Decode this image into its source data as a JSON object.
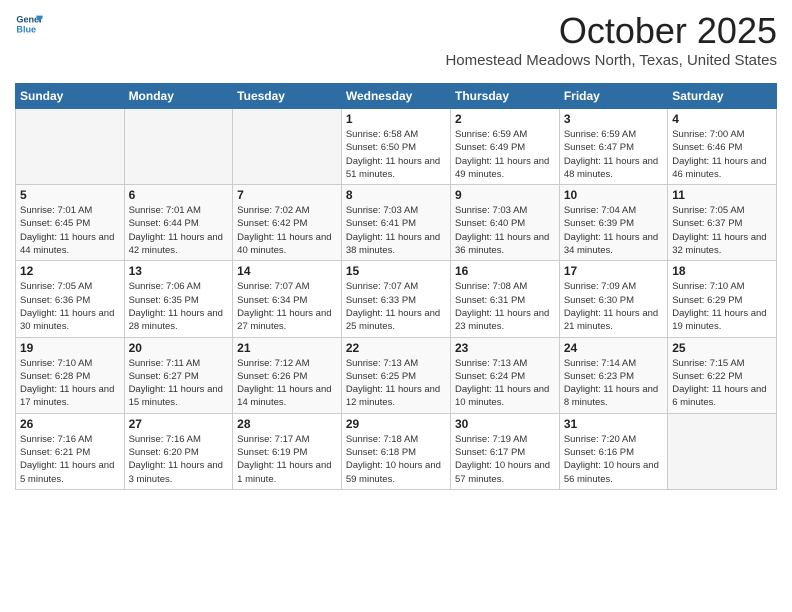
{
  "header": {
    "logo_line1": "General",
    "logo_line2": "Blue",
    "month_title": "October 2025",
    "subtitle": "Homestead Meadows North, Texas, United States"
  },
  "weekdays": [
    "Sunday",
    "Monday",
    "Tuesday",
    "Wednesday",
    "Thursday",
    "Friday",
    "Saturday"
  ],
  "weeks": [
    [
      {
        "day": "",
        "info": ""
      },
      {
        "day": "",
        "info": ""
      },
      {
        "day": "",
        "info": ""
      },
      {
        "day": "1",
        "info": "Sunrise: 6:58 AM\nSunset: 6:50 PM\nDaylight: 11 hours and 51 minutes."
      },
      {
        "day": "2",
        "info": "Sunrise: 6:59 AM\nSunset: 6:49 PM\nDaylight: 11 hours and 49 minutes."
      },
      {
        "day": "3",
        "info": "Sunrise: 6:59 AM\nSunset: 6:47 PM\nDaylight: 11 hours and 48 minutes."
      },
      {
        "day": "4",
        "info": "Sunrise: 7:00 AM\nSunset: 6:46 PM\nDaylight: 11 hours and 46 minutes."
      }
    ],
    [
      {
        "day": "5",
        "info": "Sunrise: 7:01 AM\nSunset: 6:45 PM\nDaylight: 11 hours and 44 minutes."
      },
      {
        "day": "6",
        "info": "Sunrise: 7:01 AM\nSunset: 6:44 PM\nDaylight: 11 hours and 42 minutes."
      },
      {
        "day": "7",
        "info": "Sunrise: 7:02 AM\nSunset: 6:42 PM\nDaylight: 11 hours and 40 minutes."
      },
      {
        "day": "8",
        "info": "Sunrise: 7:03 AM\nSunset: 6:41 PM\nDaylight: 11 hours and 38 minutes."
      },
      {
        "day": "9",
        "info": "Sunrise: 7:03 AM\nSunset: 6:40 PM\nDaylight: 11 hours and 36 minutes."
      },
      {
        "day": "10",
        "info": "Sunrise: 7:04 AM\nSunset: 6:39 PM\nDaylight: 11 hours and 34 minutes."
      },
      {
        "day": "11",
        "info": "Sunrise: 7:05 AM\nSunset: 6:37 PM\nDaylight: 11 hours and 32 minutes."
      }
    ],
    [
      {
        "day": "12",
        "info": "Sunrise: 7:05 AM\nSunset: 6:36 PM\nDaylight: 11 hours and 30 minutes."
      },
      {
        "day": "13",
        "info": "Sunrise: 7:06 AM\nSunset: 6:35 PM\nDaylight: 11 hours and 28 minutes."
      },
      {
        "day": "14",
        "info": "Sunrise: 7:07 AM\nSunset: 6:34 PM\nDaylight: 11 hours and 27 minutes."
      },
      {
        "day": "15",
        "info": "Sunrise: 7:07 AM\nSunset: 6:33 PM\nDaylight: 11 hours and 25 minutes."
      },
      {
        "day": "16",
        "info": "Sunrise: 7:08 AM\nSunset: 6:31 PM\nDaylight: 11 hours and 23 minutes."
      },
      {
        "day": "17",
        "info": "Sunrise: 7:09 AM\nSunset: 6:30 PM\nDaylight: 11 hours and 21 minutes."
      },
      {
        "day": "18",
        "info": "Sunrise: 7:10 AM\nSunset: 6:29 PM\nDaylight: 11 hours and 19 minutes."
      }
    ],
    [
      {
        "day": "19",
        "info": "Sunrise: 7:10 AM\nSunset: 6:28 PM\nDaylight: 11 hours and 17 minutes."
      },
      {
        "day": "20",
        "info": "Sunrise: 7:11 AM\nSunset: 6:27 PM\nDaylight: 11 hours and 15 minutes."
      },
      {
        "day": "21",
        "info": "Sunrise: 7:12 AM\nSunset: 6:26 PM\nDaylight: 11 hours and 14 minutes."
      },
      {
        "day": "22",
        "info": "Sunrise: 7:13 AM\nSunset: 6:25 PM\nDaylight: 11 hours and 12 minutes."
      },
      {
        "day": "23",
        "info": "Sunrise: 7:13 AM\nSunset: 6:24 PM\nDaylight: 11 hours and 10 minutes."
      },
      {
        "day": "24",
        "info": "Sunrise: 7:14 AM\nSunset: 6:23 PM\nDaylight: 11 hours and 8 minutes."
      },
      {
        "day": "25",
        "info": "Sunrise: 7:15 AM\nSunset: 6:22 PM\nDaylight: 11 hours and 6 minutes."
      }
    ],
    [
      {
        "day": "26",
        "info": "Sunrise: 7:16 AM\nSunset: 6:21 PM\nDaylight: 11 hours and 5 minutes."
      },
      {
        "day": "27",
        "info": "Sunrise: 7:16 AM\nSunset: 6:20 PM\nDaylight: 11 hours and 3 minutes."
      },
      {
        "day": "28",
        "info": "Sunrise: 7:17 AM\nSunset: 6:19 PM\nDaylight: 11 hours and 1 minute."
      },
      {
        "day": "29",
        "info": "Sunrise: 7:18 AM\nSunset: 6:18 PM\nDaylight: 10 hours and 59 minutes."
      },
      {
        "day": "30",
        "info": "Sunrise: 7:19 AM\nSunset: 6:17 PM\nDaylight: 10 hours and 57 minutes."
      },
      {
        "day": "31",
        "info": "Sunrise: 7:20 AM\nSunset: 6:16 PM\nDaylight: 10 hours and 56 minutes."
      },
      {
        "day": "",
        "info": ""
      }
    ]
  ]
}
